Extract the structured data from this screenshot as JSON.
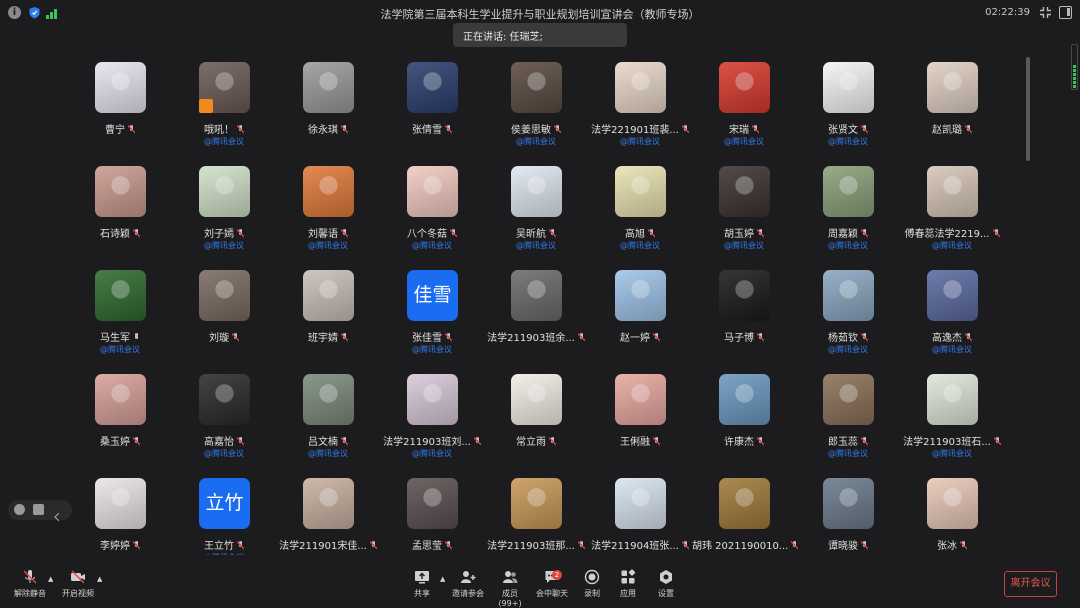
{
  "window": {
    "title": "法学院第三届本科生学业提升与职业规划培训宣讲会（教师专场）",
    "clock": "02:22:39",
    "speaking": "正在讲话: 任瑞芝;"
  },
  "colors": {
    "background": "#1c1c1e",
    "link_blue": "#2f7df0",
    "leave_red": "#e05a4e",
    "signal_green": "#3fc15c"
  },
  "participants": [
    {
      "name": "曹宁",
      "tag": "",
      "color": "#e8e4f2"
    },
    {
      "name": "哦吼！",
      "tag": "@腾讯会议",
      "color": "#6b5a55"
    },
    {
      "name": "徐永琪",
      "tag": "",
      "color": "#9a9a9a"
    },
    {
      "name": "张倩雪",
      "tag": "",
      "color": "#2a3e6e"
    },
    {
      "name": "侯姜思敏",
      "tag": "@腾讯会议",
      "color": "#5a4a40"
    },
    {
      "name": "法学221901班裴...",
      "tag": "@腾讯会议",
      "color": "#e9d7c8"
    },
    {
      "name": "宋瑞",
      "tag": "@腾讯会议",
      "color": "#d63a2e"
    },
    {
      "name": "张贤文",
      "tag": "@腾讯会议",
      "color": "#f4f4f4"
    },
    {
      "name": "赵凯璐",
      "tag": "",
      "color": "#e0cfc2"
    },
    {
      "name": "石诗颖",
      "tag": "",
      "color": "#c99a8e"
    },
    {
      "name": "刘子嫣",
      "tag": "@腾讯会议",
      "color": "#cfe0c8"
    },
    {
      "name": "刘馨语",
      "tag": "@腾讯会议",
      "color": "#e07a3a"
    },
    {
      "name": "八个冬菇",
      "tag": "@腾讯会议",
      "color": "#f2c9c0"
    },
    {
      "name": "吴昕航",
      "tag": "@腾讯会议",
      "color": "#dfe8f0"
    },
    {
      "name": "高旭",
      "tag": "@腾讯会议",
      "color": "#e8e2b0"
    },
    {
      "name": "胡玉婷",
      "tag": "@腾讯会议",
      "color": "#3a3230"
    },
    {
      "name": "周嘉颖",
      "tag": "@腾讯会议",
      "color": "#8aa07a"
    },
    {
      "name": "傅春蕊法学2219...",
      "tag": "@腾讯会议",
      "color": "#d6c6b6"
    },
    {
      "name": "马生军",
      "tag": "@腾讯会议",
      "color": "#2e6a2e",
      "mic_on": true
    },
    {
      "name": "刘璇",
      "tag": "",
      "color": "#7a6a60"
    },
    {
      "name": "班宇婧",
      "tag": "",
      "color": "#c8c0b8"
    },
    {
      "name": "张佳雪",
      "tag": "@腾讯会议",
      "color": "#1a6cf0",
      "text": "佳雪"
    },
    {
      "name": "法学211903班余...",
      "tag": "",
      "color": "#6a6a6a"
    },
    {
      "name": "赵一婷",
      "tag": "",
      "color": "#9ec4e8"
    },
    {
      "name": "马子博",
      "tag": "",
      "color": "#1a1a1a"
    },
    {
      "name": "杨茹钦",
      "tag": "@腾讯会议",
      "color": "#8aa6c0"
    },
    {
      "name": "高逸杰",
      "tag": "@腾讯会议",
      "color": "#5a6aa0"
    },
    {
      "name": "桑玉婷",
      "tag": "",
      "color": "#d8a098"
    },
    {
      "name": "高嘉怡",
      "tag": "@腾讯会议",
      "color": "#2a2a2a"
    },
    {
      "name": "吕文楠",
      "tag": "@腾讯会议",
      "color": "#7a8a7a"
    },
    {
      "name": "法学211903班刘...",
      "tag": "@腾讯会议",
      "color": "#d8c8d8"
    },
    {
      "name": "常立雨",
      "tag": "",
      "color": "#f2eee6"
    },
    {
      "name": "王俐融",
      "tag": "",
      "color": "#e8a8a0"
    },
    {
      "name": "许康杰",
      "tag": "",
      "color": "#6a98c0"
    },
    {
      "name": "郎玉蕊",
      "tag": "@腾讯会议",
      "color": "#8a7058"
    },
    {
      "name": "法学211903班石...",
      "tag": "@腾讯会议",
      "color": "#dfe6d8"
    },
    {
      "name": "李婷婷",
      "tag": "",
      "color": "#ece4e4"
    },
    {
      "name": "王立竹",
      "tag": "@腾讯会议",
      "color": "#1a6cf0",
      "text": "立竹"
    },
    {
      "name": "法学211901宋佳...",
      "tag": "",
      "color": "#c8b0a0"
    },
    {
      "name": "孟思莹",
      "tag": "",
      "color": "#5a5050"
    },
    {
      "name": "法学211903班那...",
      "tag": "",
      "color": "#c89858"
    },
    {
      "name": "法学211904班张...",
      "tag": "",
      "color": "#d8e4ee"
    },
    {
      "name": "胡玮 2021190010...",
      "tag": "",
      "color": "#a07a3a"
    },
    {
      "name": "谭晓骏",
      "tag": "",
      "color": "#6a7a8a"
    },
    {
      "name": "张冰",
      "tag": "",
      "color": "#e8c8b8"
    }
  ],
  "toolbar": {
    "unmute": "解除静音",
    "start_video": "开启视频",
    "share": "共享",
    "invite": "邀请参会",
    "members": "成员(99+)",
    "chat": "会中聊天",
    "chat_count": "2",
    "record": "录制",
    "apps": "应用",
    "settings": "设置",
    "leave": "离开会议"
  }
}
